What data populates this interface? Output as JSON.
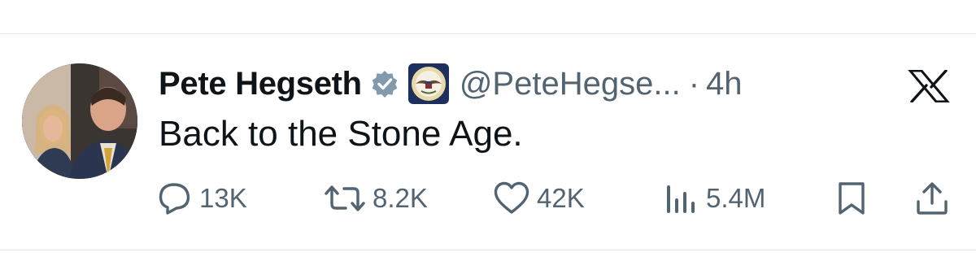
{
  "post": {
    "author_name": "Pete Hegseth",
    "handle": "@PeteHegse...",
    "separator": "·",
    "time": "4h",
    "text": "Back to the Stone Age."
  },
  "icons": {
    "verified": "verified-badge-icon",
    "affiliation": "department-seal-icon",
    "platform": "x-logo-icon",
    "reply": "reply-icon",
    "repost": "repost-icon",
    "like": "heart-icon",
    "views": "views-icon",
    "bookmark": "bookmark-icon",
    "share": "share-icon"
  },
  "metrics": {
    "replies": "13K",
    "reposts": "8.2K",
    "likes": "42K",
    "views": "5.4M"
  },
  "colors": {
    "text": "#0f1419",
    "secondary": "#536471",
    "verified_badge": "#829aab",
    "seal_navy": "#1d2f5c",
    "divider": "#e6e6e6"
  }
}
